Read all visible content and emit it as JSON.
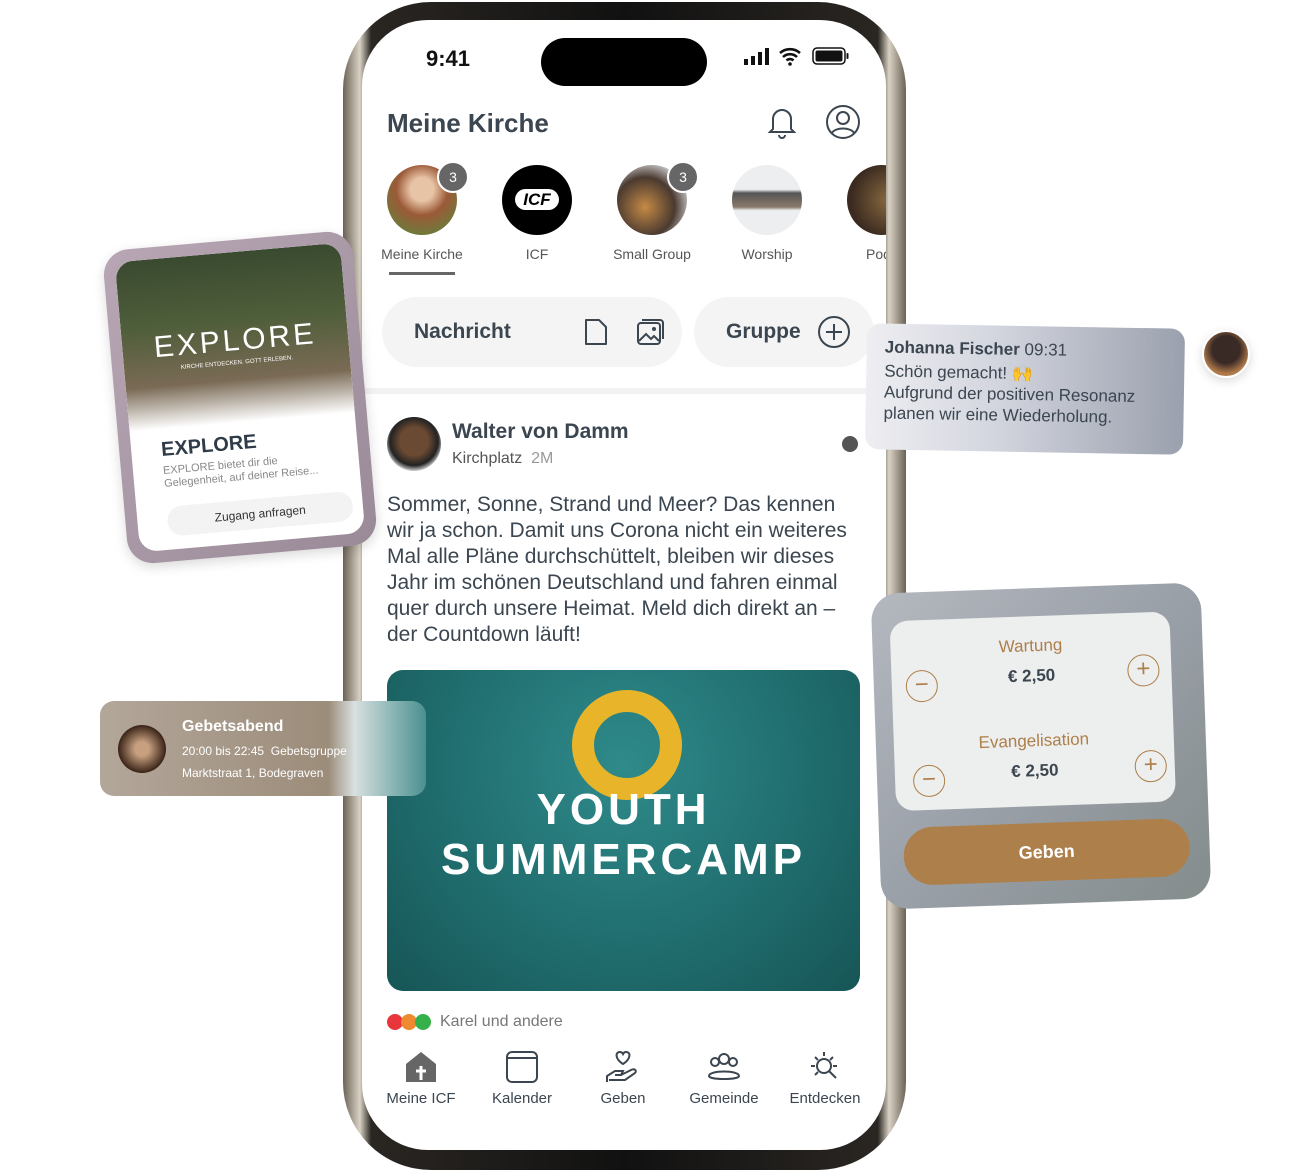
{
  "status": {
    "time": "9:41"
  },
  "header": {
    "title": "Meine Kirche",
    "bell_icon": "bell-icon",
    "profile_icon": "user-circle-icon"
  },
  "stories": [
    {
      "label": "Meine Kirche",
      "badge": "3",
      "active": true
    },
    {
      "label": "ICF",
      "logo": "ICF"
    },
    {
      "label": "Small Group",
      "badge": "3"
    },
    {
      "label": "Worship"
    },
    {
      "label": "Podc"
    }
  ],
  "compose": {
    "message_label": "Nachricht",
    "group_label": "Gruppe"
  },
  "post": {
    "author": "Walter von Damm",
    "location": "Kirchplatz",
    "age": "2M",
    "text": "Sommer, Sonne, Strand und Meer? Das kennen wir ja schon. Damit uns Corona nicht ein weiteres Mal alle Pläne durchschüttelt, bleiben wir dieses Jahr im schönen Deutschland und fahren einmal quer durch unsere Heimat. Meld dich direkt an – der Countdown läuft!",
    "image_title_1": "YOUTH",
    "image_title_2": "SUMMERCAMP",
    "reactions": "Karel und andere"
  },
  "tabbar": [
    {
      "label": "Meine ICF",
      "icon": "church-icon"
    },
    {
      "label": "Kalender",
      "icon": "calendar-icon"
    },
    {
      "label": "Geben",
      "icon": "hand-heart-icon"
    },
    {
      "label": "Gemeinde",
      "icon": "group-icon"
    },
    {
      "label": "Entdecken",
      "icon": "sun-search-icon"
    }
  ],
  "explore_card": {
    "image_title": "EXPLORE",
    "image_subtitle": "KIRCHE ENTDECKEN. GOTT ERLEBEN.",
    "title": "EXPLORE",
    "description": "EXPLORE bietet dir die Gelegenheit, auf deiner Reise...",
    "button": "Zugang anfragen"
  },
  "chat_card": {
    "name": "Johanna Fischer",
    "time": "09:31",
    "line1": "Schön gemacht! 🙌",
    "line2": "Aufgrund der positiven Resonanz planen wir eine Wiederholung."
  },
  "event_card": {
    "title": "Gebetsabend",
    "time": "20:00 bis 22:45",
    "group": "Gebetsgruppe",
    "address": "Marktstraat 1, Bodegraven"
  },
  "give_card": {
    "items": [
      {
        "label": "Wartung",
        "amount": "€ 2,50"
      },
      {
        "label": "Evangelisation",
        "amount": "€ 2,50"
      }
    ],
    "button": "Geben"
  },
  "colors": {
    "accent": "#ad7f4a",
    "text": "#3b4650"
  }
}
